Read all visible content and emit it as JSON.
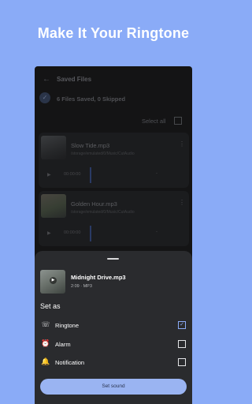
{
  "headline": "Make It Your Ringtone",
  "appbar": {
    "back_icon": "arrow-left",
    "title": "Saved Files"
  },
  "status": {
    "icon": "check-circle",
    "text": "6 Files Saved, 0 Skipped"
  },
  "select_all": {
    "label": "Select all",
    "checked": false
  },
  "files": [
    {
      "name": "Slow Tide.mp3",
      "path": "/storage/emulated/0/Music/CutAudio",
      "time": "00:00:00",
      "end": "-"
    },
    {
      "name": "Golden Hour.mp3",
      "path": "/storage/emulated/0/Music/CutAudio",
      "time": "00:00:00",
      "end": "-"
    }
  ],
  "sheet": {
    "name": "Midnight Drive.mp3",
    "meta": "2:09 · MP3",
    "set_as": "Set as",
    "options": [
      {
        "icon": "ringtone-icon",
        "label": "Ringtone",
        "checked": true
      },
      {
        "icon": "alarm-icon",
        "label": "Alarm",
        "checked": false
      },
      {
        "icon": "notification-icon",
        "label": "Notification",
        "checked": false
      }
    ],
    "button": "Set sound"
  },
  "colors": {
    "background": "#8aabf7",
    "accent": "#8aabf7",
    "sheet": "#2a2b2e"
  }
}
